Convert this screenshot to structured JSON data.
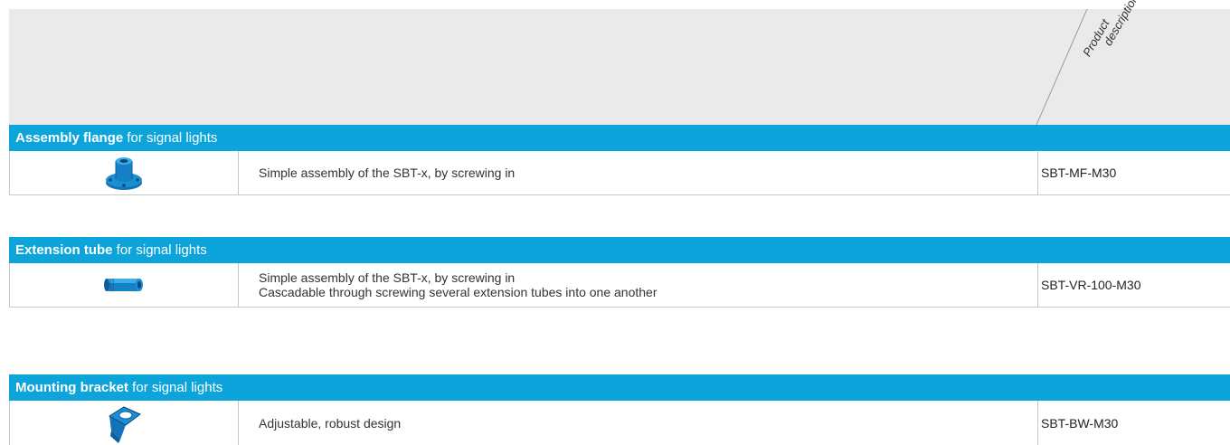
{
  "header": {
    "column_label_line1": "Product",
    "column_label_line2": "description"
  },
  "groups": [
    {
      "title_bold": "Assembly flange",
      "title_rest": " for signal lights",
      "icon": "assembly-flange-icon",
      "description_lines": [
        "Simple assembly of the SBT-x, by screwing in"
      ],
      "product_code": "SBT-MF-M30"
    },
    {
      "title_bold": "Extension tube",
      "title_rest": " for signal lights",
      "icon": "extension-tube-icon",
      "description_lines": [
        "Simple assembly of the SBT-x, by screwing in",
        "Cascadable through screwing several extension tubes into one another"
      ],
      "product_code": "SBT-VR-100-M30"
    },
    {
      "title_bold": "Mounting bracket",
      "title_rest": " for signal lights",
      "icon": "mounting-bracket-icon",
      "description_lines": [
        "Adjustable, robust design"
      ],
      "product_code": "SBT-BW-M30"
    }
  ],
  "colors": {
    "accent": "#0da4dc",
    "header_background": "#eaeaea",
    "product_icon_blue": "#1a8fd4"
  }
}
